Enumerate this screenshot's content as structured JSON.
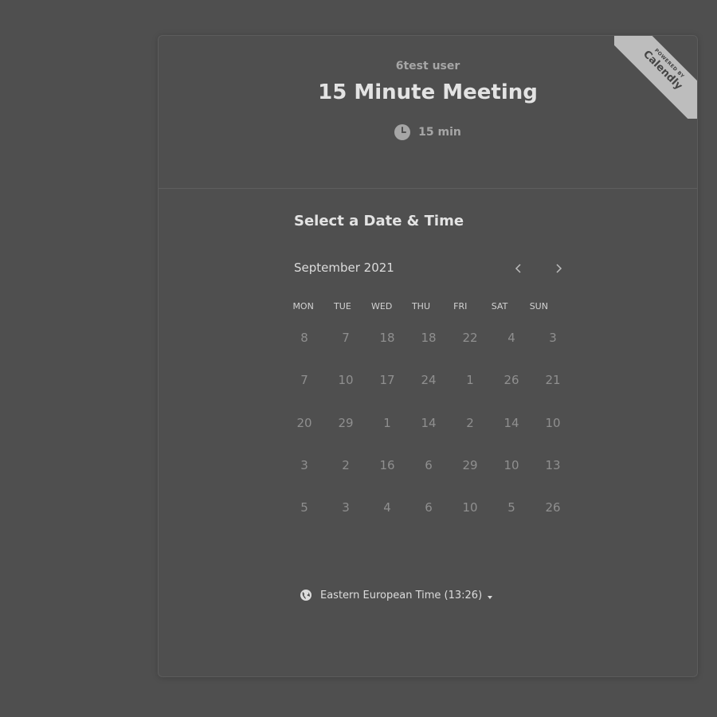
{
  "header": {
    "host_name": "6test user",
    "event_name": "15 Minute Meeting",
    "duration": "15 min"
  },
  "ribbon": {
    "small_text": "POWERED BY",
    "brand": "Calendly"
  },
  "main": {
    "section_title": "Select a Date & Time",
    "month_label": "September 2021",
    "weekdays": [
      "MON",
      "TUE",
      "WED",
      "THU",
      "FRI",
      "SAT",
      "SUN"
    ],
    "weeks": [
      [
        "8",
        "7",
        "18",
        "18",
        "22",
        "4",
        "3"
      ],
      [
        "7",
        "10",
        "17",
        "24",
        "1",
        "26",
        "21"
      ],
      [
        "20",
        "29",
        "1",
        "14",
        "2",
        "14",
        "10"
      ],
      [
        "3",
        "2",
        "16",
        "6",
        "29",
        "10",
        "13"
      ],
      [
        "5",
        "3",
        "4",
        "6",
        "10",
        "5",
        "26"
      ]
    ],
    "timezone": "Eastern European Time (13:26)"
  },
  "icons": {
    "clock": "clock-icon",
    "prev": "chevron-left-icon",
    "next": "chevron-right-icon",
    "globe": "globe-icon",
    "caret": "caret-down-icon"
  },
  "colors": {
    "background": "#4f4f4f",
    "title": "#e3e3e3",
    "muted": "#a6a6a6",
    "day_disabled": "#8f8f8f",
    "ribbon": "#bdbdbd"
  }
}
